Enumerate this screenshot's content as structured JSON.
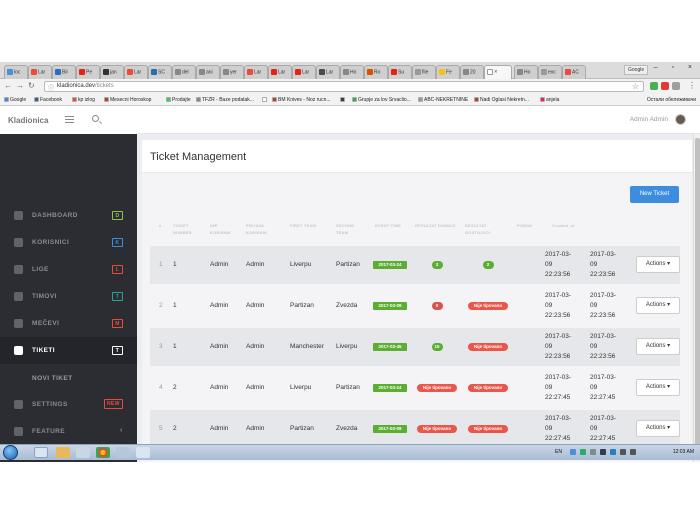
{
  "browser": {
    "tabs": [
      {
        "label": "loc",
        "color": "#4a90d9"
      },
      {
        "label": "Lar",
        "color": "#e74c3c"
      },
      {
        "label": "Bil",
        "color": "#2c6fbf"
      },
      {
        "label": "Pe",
        "color": "#e62117"
      },
      {
        "label": "jan",
        "color": "#333333"
      },
      {
        "label": "Lar",
        "color": "#e74c3c"
      },
      {
        "label": "SC",
        "color": "#2b6cb0"
      },
      {
        "label": "del",
        "color": "#888888"
      },
      {
        "label": "ani",
        "color": "#888888"
      },
      {
        "label": "yer",
        "color": "#888888"
      },
      {
        "label": "Lar",
        "color": "#e74c3c"
      },
      {
        "label": "Lar",
        "color": "#e62117"
      },
      {
        "label": "Lar",
        "color": "#e62117"
      },
      {
        "label": "Lar",
        "color": "#4b4b4b"
      },
      {
        "label": "Ho",
        "color": "#888888"
      },
      {
        "label": "Ro",
        "color": "#d35400"
      },
      {
        "label": "Su",
        "color": "#e62117"
      },
      {
        "label": "file",
        "color": "#999999"
      },
      {
        "label": "Fe",
        "color": "#f1c40f"
      },
      {
        "label": "20",
        "color": "#888888"
      }
    ],
    "active_tab": {
      "label": "",
      "close": "×"
    },
    "trailing_tabs": [
      {
        "label": "Ho",
        "color": "#888888"
      },
      {
        "label": "exc",
        "color": "#999999"
      },
      {
        "label": "AC",
        "color": "#e74c3c"
      }
    ],
    "user_chip": "Google",
    "url_host": "kladionica.dev",
    "url_path": "/tickets",
    "bookmarks": [
      {
        "label": "Google",
        "color": "#4285f4"
      },
      {
        "label": "Facebook",
        "color": "#3b5998"
      },
      {
        "label": "kp izlog",
        "color": "#e74c3c"
      },
      {
        "label": "Mesecni Horoskop",
        "color": "#c0392b"
      },
      {
        "label": "Prodajte",
        "color": "#2ecc71"
      },
      {
        "label": "TFZR - Baze podatak...",
        "color": "#7f8c8d"
      },
      {
        "label": "",
        "color": "#ffffff"
      },
      {
        "label": "BM Knives - Noz rucn...",
        "color": "#c0392b"
      },
      {
        "label": "",
        "color": "#2c3e50"
      },
      {
        "label": "Grupje za lov Srvaclio...",
        "color": "#27ae60"
      },
      {
        "label": "ABC-NEKRETNINE",
        "color": "#999999"
      },
      {
        "label": "Nadi Oglasi Nekretn...",
        "color": "#c0392b"
      },
      {
        "label": "anjela",
        "color": "#e91e63"
      }
    ],
    "other_bookmarks": "Остали обележивачи"
  },
  "app": {
    "brand": "Kladionica",
    "admin_name": "Admin Admin"
  },
  "sidebar": {
    "items": [
      {
        "label": "DASHBOARD",
        "badge": "D",
        "badge_color": "#8bc34a",
        "icon": "dashboard-icon"
      },
      {
        "label": "KORISNICI",
        "badge": "K",
        "badge_color": "#3c8dde",
        "icon": "users-icon"
      },
      {
        "label": "LIGE",
        "badge": "L",
        "badge_color": "#e74c3c",
        "icon": "leagues-icon"
      },
      {
        "label": "TIMOVI",
        "badge": "T",
        "badge_color": "#26a69a",
        "icon": "teams-icon"
      },
      {
        "label": "MEČEVI",
        "badge": "M",
        "badge_color": "#e74c3c",
        "icon": "matches-icon"
      },
      {
        "label": "TIKETI",
        "badge": "T",
        "badge_color": "#ffffff",
        "icon": "ticket-icon"
      }
    ],
    "sub_item": "NOVI TIKET",
    "settings": {
      "label": "SETTINGS",
      "badge": "NEW"
    },
    "feature": {
      "label": "FEATURE",
      "chevron": "‹"
    }
  },
  "main": {
    "title": "Ticket Management",
    "new_button": "New Ticket",
    "columns": [
      "#",
      "TICKET NUMBER",
      "IME KORISNIK",
      "PRIJAVA KORISNIK",
      "FIRST TEAM",
      "SECOND TEAM",
      "EVENT TIME",
      "REZULTAT DOMACI",
      "REZULTAT GOSTUJUCI",
      "POENA",
      "Created_at",
      ""
    ],
    "rows": [
      {
        "idx": "1",
        "ticket": "1",
        "user": "Admin",
        "login": "Admin",
        "team1": "Liverpu",
        "team2": "Partizan",
        "event": "2017-03-24",
        "home": "3",
        "home_color": "#5cae33",
        "away": "2",
        "away_color": "#5cae33",
        "created": [
          "2017-03-",
          "09",
          "22:23:56"
        ],
        "updated": [
          "2017-03-",
          "09",
          "22:23:56"
        ],
        "action": "Actions ▾"
      },
      {
        "idx": "2",
        "ticket": "1",
        "user": "Admin",
        "login": "Admin",
        "team1": "Partizan",
        "team2": "Zvezda",
        "event": "2017-03-09",
        "home": "0",
        "home_color": "#d9534f",
        "away": "Nije tipovano",
        "away_color": "#e8574a",
        "created": [
          "2017-03-",
          "09",
          "22:23:56"
        ],
        "updated": [
          "2017-03-",
          "09",
          "22:23:56"
        ],
        "action": "Actions ▾"
      },
      {
        "idx": "3",
        "ticket": "1",
        "user": "Admin",
        "login": "Admin",
        "team1": "Manchester",
        "team2": "Liverpu",
        "event": "2017-03-45",
        "home": "15",
        "home_color": "#5cae33",
        "away": "Nije tipovano",
        "away_color": "#e8574a",
        "created": [
          "2017-03-",
          "09",
          "22:23:56"
        ],
        "updated": [
          "2017-03-",
          "09",
          "22:23:56"
        ],
        "action": "Actions ▾"
      },
      {
        "idx": "4",
        "ticket": "2",
        "user": "Admin",
        "login": "Admin",
        "team1": "Liverpu",
        "team2": "Partizan",
        "event": "2017-03-24",
        "home": "Nije tipovano",
        "home_color": "#e8574a",
        "away": "Nije tipovano",
        "away_color": "#e8574a",
        "created": [
          "2017-03-",
          "09",
          "22:27:45"
        ],
        "updated": [
          "2017-03-",
          "09",
          "22:27:45"
        ],
        "action": "Actions ▾"
      },
      {
        "idx": "5",
        "ticket": "2",
        "user": "Admin",
        "login": "Admin",
        "team1": "Partizan",
        "team2": "Zvezda",
        "event": "2017-03-09",
        "home": "Nije tipovano",
        "home_color": "#e8574a",
        "away": "Nije tipovano",
        "away_color": "#e8574a",
        "created": [
          "2017-03-",
          "09",
          "22:27:45"
        ],
        "updated": [
          "2017-03-",
          "09",
          "22:27:45"
        ],
        "action": "Actions ▾"
      }
    ]
  },
  "taskbar": {
    "lang": "EN",
    "clock": "12:03 AM"
  }
}
